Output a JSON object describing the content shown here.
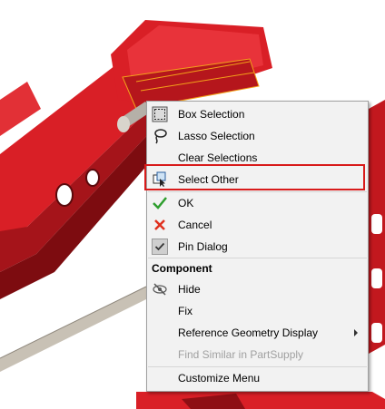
{
  "menu": {
    "items": [
      {
        "label": "Box Selection",
        "icon": "box-selection-icon"
      },
      {
        "label": "Lasso Selection",
        "icon": "lasso-selection-icon"
      },
      {
        "label": "Clear Selections",
        "icon": ""
      },
      {
        "label": "Select Other",
        "icon": "select-other-icon",
        "highlighted": true
      },
      {
        "label": "OK",
        "icon": "checkmark-icon"
      },
      {
        "label": "Cancel",
        "icon": "cancel-x-icon"
      },
      {
        "label": "Pin Dialog",
        "icon": "pin-dialog-icon",
        "checked": true
      }
    ],
    "section_header": "Component",
    "component_items": [
      {
        "label": "Hide",
        "icon": "hide-icon"
      },
      {
        "label": "Fix",
        "icon": ""
      },
      {
        "label": "Reference Geometry Display",
        "icon": "",
        "submenu": true
      },
      {
        "label": "Find Similar in PartSupply",
        "icon": "",
        "disabled": true
      },
      {
        "label": "Customize Menu",
        "icon": ""
      }
    ]
  },
  "colors": {
    "model_red": "#d91f26",
    "model_dark_red": "#8e0f14",
    "highlight_border": "#d81b1b",
    "accent_green": "#2e9e2e",
    "accent_red": "#e0301e"
  }
}
